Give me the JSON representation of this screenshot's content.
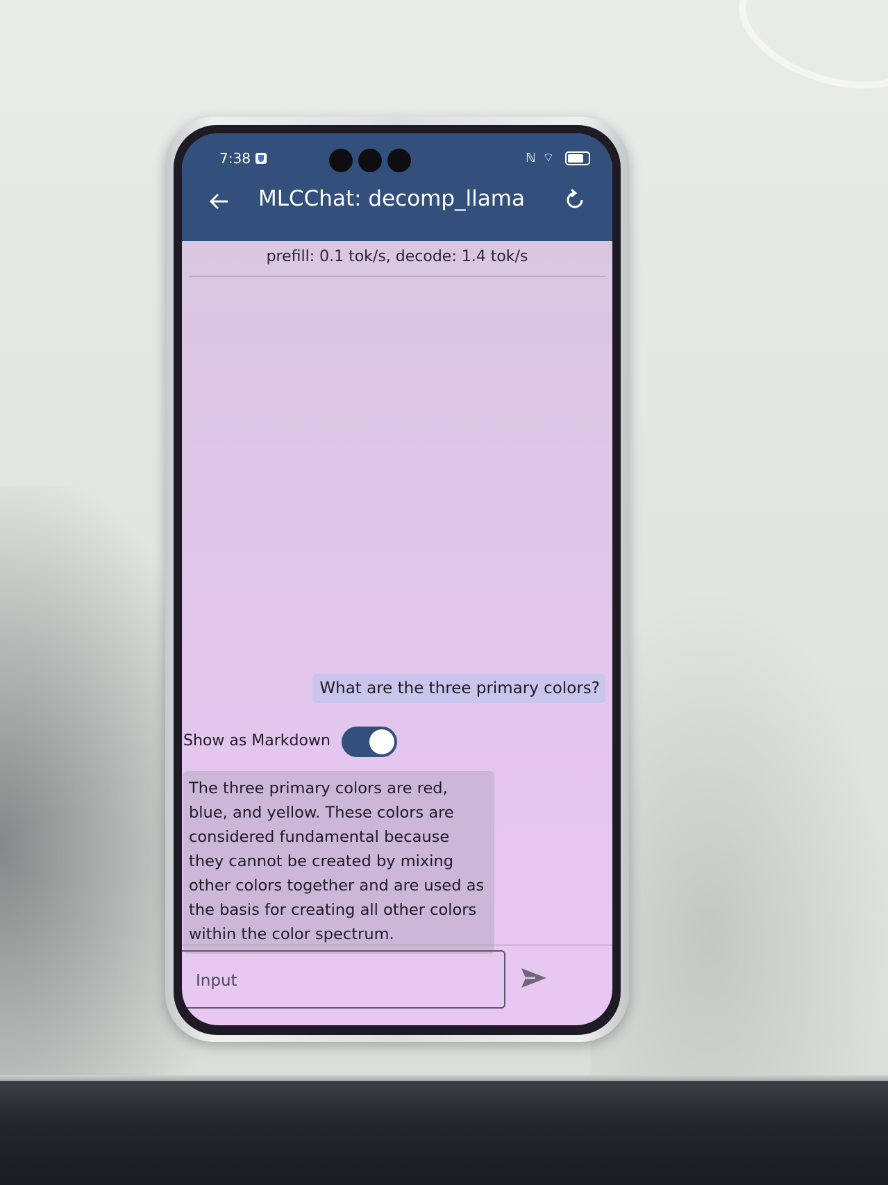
{
  "status_bar": {
    "time": "7:38",
    "icons_text": "ℕ ⌔"
  },
  "app_bar": {
    "title": "MLCChat: decomp_llama",
    "back_icon": "arrow-left-icon",
    "reset_icon": "refresh-icon"
  },
  "stats": {
    "text": "prefill: 0.1 tok/s, decode: 1.4 tok/s"
  },
  "messages": [
    {
      "role": "user",
      "text": "What are the three primary colors?"
    },
    {
      "role": "assistant",
      "text": "The three primary colors are red, blue, and yellow. These colors are considered fundamental because they cannot be created by mixing other colors together and are used as the basis for creating all other colors within the color spectrum."
    }
  ],
  "markdown_toggle": {
    "label": "Show as Markdown",
    "on": true
  },
  "input": {
    "placeholder": "Input",
    "value": ""
  },
  "colors": {
    "app_bar": "#33507c",
    "user_bubble": "#c9c5ec",
    "assistant_bubble": "#cdb7d8",
    "screen_background": "#dcc6e4"
  }
}
